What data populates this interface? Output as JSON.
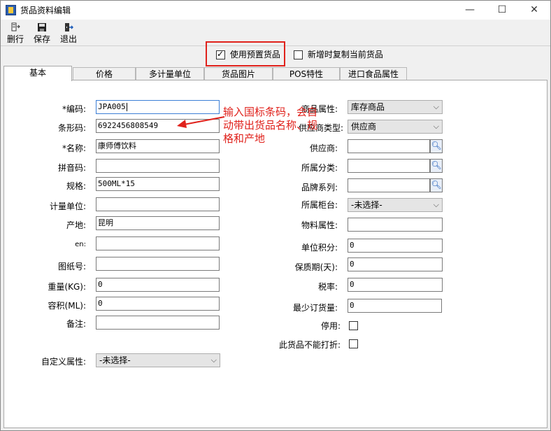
{
  "window": {
    "title": "货品资料编辑",
    "minimize": "—",
    "maximize": "☐",
    "close": "✕"
  },
  "toolbar": {
    "delete_label": "删行",
    "save_label": "保存",
    "exit_label": "退出"
  },
  "options": {
    "use_preset_label": "使用预置货品",
    "use_preset_checked": true,
    "copy_current_label": "新增时复制当前货品",
    "copy_current_checked": false
  },
  "tabs": [
    "基本",
    "价格",
    "多计量单位",
    "货品图片",
    "POS特性",
    "进口食品属性"
  ],
  "left_fields": {
    "code": {
      "label": "*编码:",
      "value": "JPA005"
    },
    "barcode": {
      "label": "条形码:",
      "value": "6922456808549"
    },
    "name": {
      "label": "*名称:",
      "value": "康师傅饮料"
    },
    "pinyin": {
      "label": "拼音码:",
      "value": ""
    },
    "spec": {
      "label": "规格:",
      "value": "500ML*15"
    },
    "unit": {
      "label": "计量单位:",
      "value": ""
    },
    "origin": {
      "label": "产地:",
      "value": "昆明"
    },
    "en": {
      "label": "en:",
      "value": ""
    },
    "drawing_no": {
      "label": "图纸号:",
      "value": ""
    },
    "weight": {
      "label": "重量(KG):",
      "value": "0"
    },
    "volume": {
      "label": "容积(ML):",
      "value": "0"
    },
    "remark": {
      "label": "备注:",
      "value": ""
    },
    "custom_attr": {
      "label": "自定义属性:",
      "value": "-未选择-"
    }
  },
  "right_fields": {
    "goods_attr": {
      "label": "商品属性:",
      "value": "库存商品"
    },
    "supplier_type": {
      "label": "供应商类型:",
      "value": "供应商"
    },
    "supplier": {
      "label": "供应商:",
      "value": ""
    },
    "category": {
      "label": "所属分类:",
      "value": ""
    },
    "brand": {
      "label": "品牌系列:",
      "value": ""
    },
    "cabinet": {
      "label": "所属柜台:",
      "value": "-未选择-"
    },
    "material_attr": {
      "label": "物料属性:",
      "value": ""
    },
    "unit_points": {
      "label": "单位积分:",
      "value": "0"
    },
    "shelf_life": {
      "label": "保质期(天):",
      "value": "0"
    },
    "tax_rate": {
      "label": "税率:",
      "value": "0"
    },
    "min_order": {
      "label": "最少订货量:",
      "value": "0"
    },
    "disabled": {
      "label": "停用:",
      "checked": false
    },
    "no_discount": {
      "label": "此货品不能打折:",
      "checked": false
    }
  },
  "annotation": {
    "text": "输入国标条码，会自动带出货品名称、规格和产地",
    "color": "#e0221c"
  }
}
